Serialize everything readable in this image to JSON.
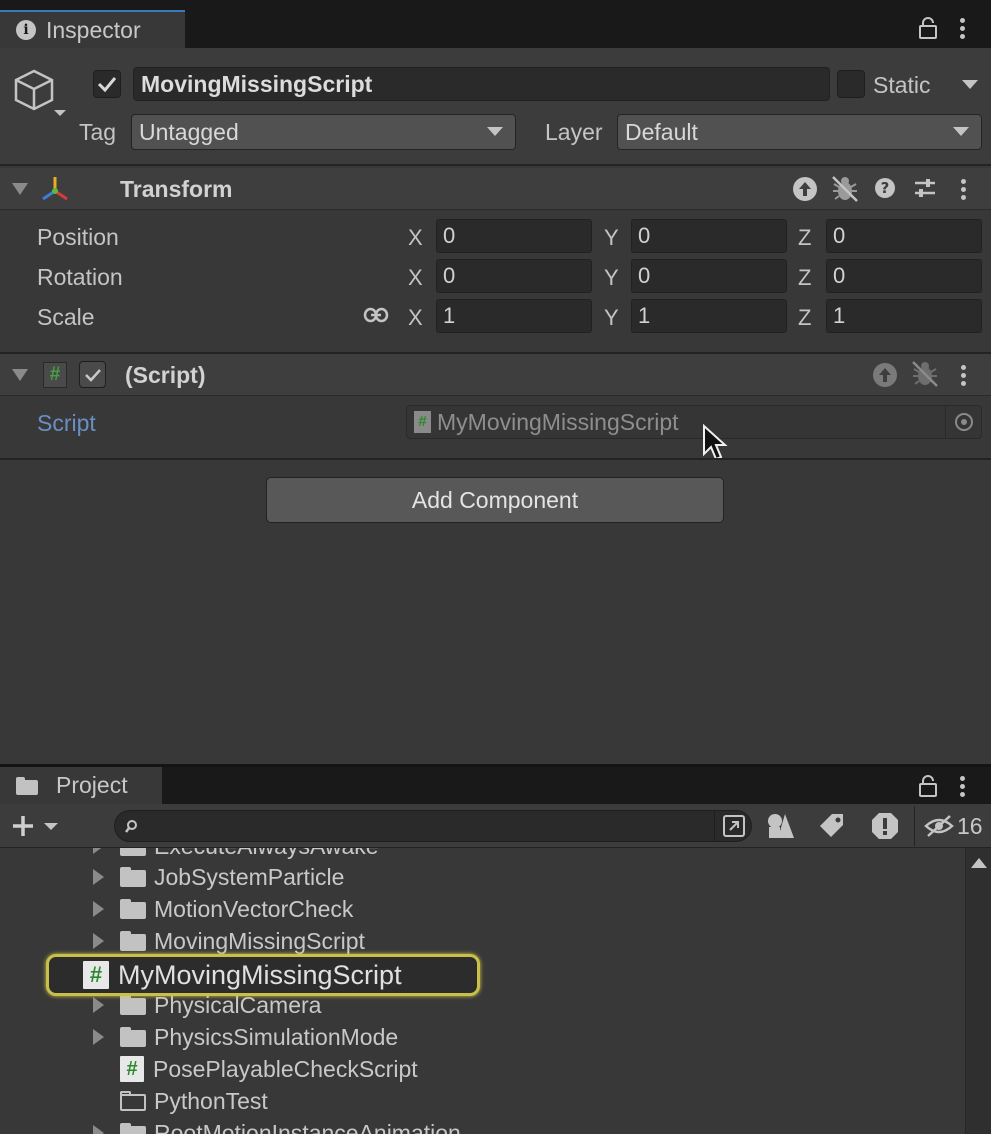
{
  "inspector": {
    "tab_label": "Inspector",
    "object_name": "MovingMissingScript",
    "static_label": "Static",
    "tag_label": "Tag",
    "tag_value": "Untagged",
    "layer_label": "Layer",
    "layer_value": "Default",
    "active_checked": true,
    "static_checked": false
  },
  "transform": {
    "title": "Transform",
    "rows": [
      {
        "label": "Position",
        "x": "0",
        "y": "0",
        "z": "0"
      },
      {
        "label": "Rotation",
        "x": "0",
        "y": "0",
        "z": "0"
      },
      {
        "label": "Scale",
        "x": "1",
        "y": "1",
        "z": "1"
      }
    ],
    "axis_x": "X",
    "axis_y": "Y",
    "axis_z": "Z"
  },
  "script_component": {
    "title": "(Script)",
    "field_label": "Script",
    "field_value": "MyMovingMissingScript"
  },
  "add_component_label": "Add Component",
  "project": {
    "tab_label": "Project",
    "hidden_count": "16",
    "items": [
      {
        "name": "ExecuteAlwaysAwake",
        "type": "folder",
        "expandable": true
      },
      {
        "name": "JobSystemParticle",
        "type": "folder",
        "expandable": true
      },
      {
        "name": "MotionVectorCheck",
        "type": "folder",
        "expandable": true
      },
      {
        "name": "MovingMissingScript",
        "type": "folder",
        "expandable": true
      },
      {
        "name": "MyMovingMissingScript",
        "type": "script",
        "dragging": true
      },
      {
        "name": "PhysicalCamera",
        "type": "folder",
        "expandable": true
      },
      {
        "name": "PhysicsSimulationMode",
        "type": "folder",
        "expandable": true
      },
      {
        "name": "PosePlayableCheckScript",
        "type": "script",
        "expandable": false
      },
      {
        "name": "PythonTest",
        "type": "empty-folder",
        "expandable": false
      },
      {
        "name": "RootMotionInstanceAnimation",
        "type": "folder",
        "expandable": true
      }
    ]
  },
  "colors": {
    "background": "#383838",
    "highlight": "#c8c04a",
    "script_link": "#6a8fc4",
    "script_hash": "#2b8a2b"
  }
}
